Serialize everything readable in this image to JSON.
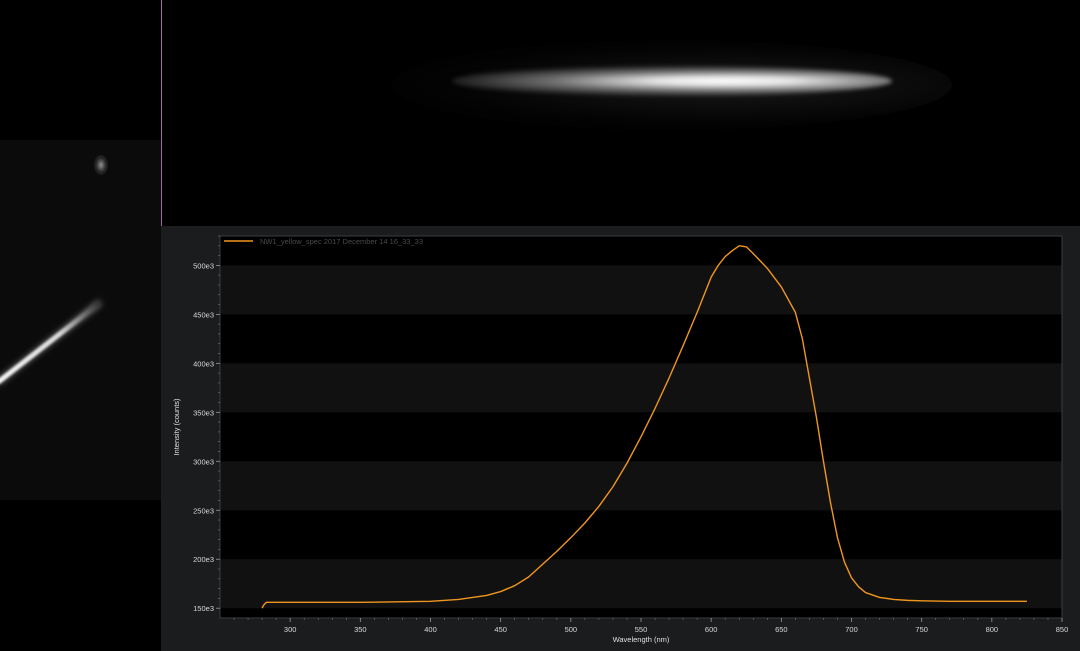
{
  "chart_data": {
    "type": "line",
    "legend": {
      "placement": "top-left",
      "entries": [
        "NW1_yellow_spec 2017 December 14 16_33_33"
      ]
    },
    "xlabel": "Wavelength (nm)",
    "ylabel": "Intensity (counts)",
    "xlim": [
      250,
      850
    ],
    "ylim": [
      140000,
      530000
    ],
    "x_ticks": [
      300,
      350,
      400,
      450,
      500,
      550,
      600,
      650,
      700,
      750,
      800,
      850
    ],
    "y_ticks": [
      150000,
      200000,
      250000,
      300000,
      350000,
      400000,
      450000,
      500000
    ],
    "y_tick_labels": [
      "150e3",
      "200e3",
      "250e3",
      "300e3",
      "350e3",
      "400e3",
      "450e3",
      "500e3"
    ],
    "grid": "alternating horizontal bands",
    "series": [
      {
        "name": "NW1_yellow_spec 2017 December 14 16_33_33",
        "color": "#f0961e",
        "x": [
          280,
          281,
          283,
          300,
          350,
          400,
          420,
          440,
          450,
          460,
          470,
          480,
          490,
          500,
          510,
          520,
          530,
          540,
          550,
          560,
          570,
          580,
          590,
          600,
          605,
          610,
          615,
          620,
          625,
          630,
          640,
          650,
          660,
          665,
          670,
          675,
          680,
          685,
          690,
          695,
          700,
          705,
          710,
          720,
          730,
          740,
          750,
          770,
          800,
          825
        ],
        "y": [
          150000,
          153000,
          156000,
          156000,
          156000,
          157000,
          159000,
          163000,
          167000,
          173000,
          182000,
          195000,
          208000,
          222000,
          237000,
          254000,
          274000,
          298000,
          325000,
          354000,
          385000,
          418000,
          452000,
          488000,
          500000,
          509000,
          515000,
          520000,
          519000,
          512000,
          497000,
          478000,
          452000,
          425000,
          385000,
          345000,
          300000,
          258000,
          222000,
          197000,
          181000,
          172000,
          166000,
          161000,
          159000,
          158000,
          157500,
          157000,
          157000,
          157000
        ]
      }
    ],
    "colors": {
      "plot_background": "#000000",
      "band": "#111111",
      "panel_background": "#1a1c1e"
    }
  }
}
